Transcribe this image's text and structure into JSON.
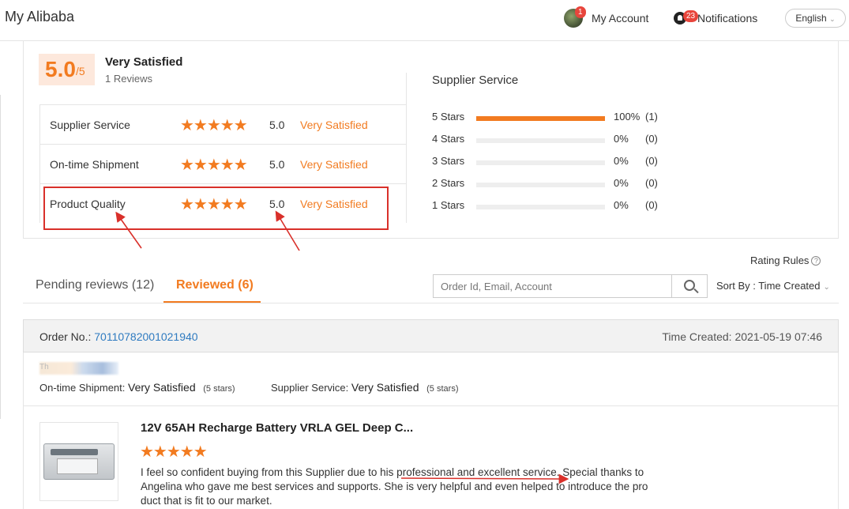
{
  "header": {
    "brand": "My Alibaba",
    "account_label": "My Account",
    "account_badge": "1",
    "notifications_label": "Notifications",
    "notifications_badge": "23",
    "language": "English"
  },
  "summary": {
    "score": "5.0",
    "score_of": "/5",
    "title": "Very Satisfied",
    "reviews": "1 Reviews",
    "rows": [
      {
        "name": "Supplier Service",
        "stars": "★★★★★",
        "value": "5.0",
        "text": "Very Satisfied"
      },
      {
        "name": "On-time Shipment",
        "stars": "★★★★★",
        "value": "5.0",
        "text": "Very Satisfied"
      },
      {
        "name": "Product Quality",
        "stars": "★★★★★",
        "value": "5.0",
        "text": "Very Satisfied"
      }
    ]
  },
  "distribution": {
    "title": "Supplier Service",
    "rows": [
      {
        "label": "5  Stars",
        "pct": "100%",
        "count": "(1)",
        "fraction": 1.0
      },
      {
        "label": "4  Stars",
        "pct": "0%",
        "count": "(0)",
        "fraction": 0
      },
      {
        "label": "3  Stars",
        "pct": "0%",
        "count": "(0)",
        "fraction": 0
      },
      {
        "label": "2  Stars",
        "pct": "0%",
        "count": "(0)",
        "fraction": 0
      },
      {
        "label": "1  Stars",
        "pct": "0%",
        "count": "(0)",
        "fraction": 0
      }
    ]
  },
  "toolbar": {
    "rating_rules": "Rating Rules",
    "tab_pending": "Pending reviews (12)",
    "tab_reviewed": "Reviewed (6)",
    "search_placeholder": "Order Id, Email, Account",
    "sort_by": "Sort By : Time Created"
  },
  "order": {
    "order_no_label": "Order No.:",
    "order_no": "70110782001021940",
    "time_created": "Time Created: 2021-05-19 07:46",
    "blurred_prefix": "Th",
    "shipment_label": "On-time Shipment:",
    "shipment_value": "Very Satisfied",
    "shipment_stars": "(5 stars)",
    "service_label": "Supplier Service:",
    "service_value": "Very Satisfied",
    "service_stars": "(5 stars)"
  },
  "product": {
    "title": "12V 65AH Recharge Battery VRLA GEL Deep C...",
    "stars": "★★★★★",
    "review": "I feel so confident buying from this Supplier due to his professional and excellent service. Special thanks to Angelina who gave me best services and supports. She is very helpful and even helped to introduce the pro duct that is fit to our market."
  },
  "colors": {
    "accent": "#f27b20",
    "link": "#2f7bc0",
    "annotation": "#d9302a"
  }
}
